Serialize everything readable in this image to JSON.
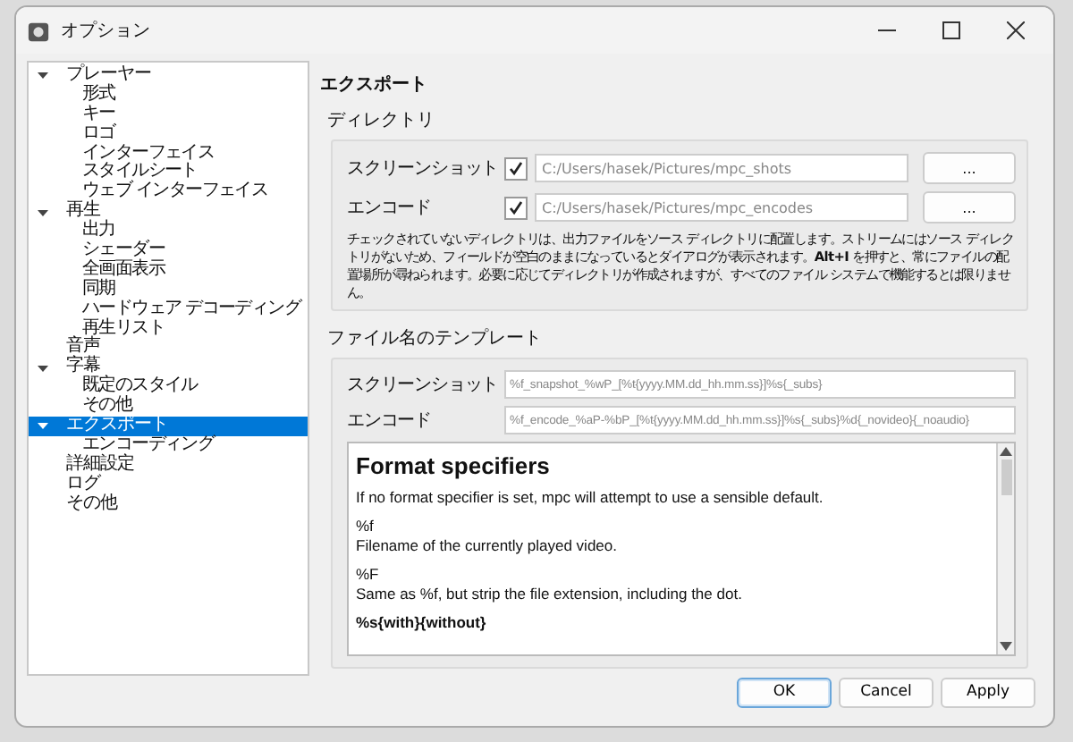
{
  "window": {
    "title": "オプション"
  },
  "tree": [
    {
      "label": "プレーヤー",
      "selected": false,
      "expanded": true,
      "children": [
        {
          "label": "形式",
          "selected": false
        },
        {
          "label": "キー",
          "selected": false
        },
        {
          "label": "ロゴ",
          "selected": false
        },
        {
          "label": "インターフェイス",
          "selected": false
        },
        {
          "label": "スタイルシート",
          "selected": false
        },
        {
          "label": "ウェブ インターフェイス",
          "selected": false
        }
      ]
    },
    {
      "label": "再生",
      "selected": false,
      "expanded": true,
      "children": [
        {
          "label": "出力",
          "selected": false
        },
        {
          "label": "シェーダー",
          "selected": false
        },
        {
          "label": "全画面表示",
          "selected": false
        },
        {
          "label": "同期",
          "selected": false
        },
        {
          "label": "ハードウェア デコーディング",
          "selected": false
        },
        {
          "label": "再生リスト",
          "selected": false
        }
      ]
    },
    {
      "label": "音声",
      "selected": false
    },
    {
      "label": "字幕",
      "selected": false,
      "expanded": true,
      "children": [
        {
          "label": "既定のスタイル",
          "selected": false
        },
        {
          "label": "その他",
          "selected": false
        }
      ]
    },
    {
      "label": "エクスポート",
      "selected": true,
      "expanded": true,
      "children": [
        {
          "label": "エンコーディング",
          "selected": false
        }
      ]
    },
    {
      "label": "詳細設定",
      "selected": false
    },
    {
      "label": "ログ",
      "selected": false
    },
    {
      "label": "その他",
      "selected": false
    }
  ],
  "page_title": "エクスポート",
  "directory": {
    "title": "ディレクトリ",
    "rows": [
      {
        "label": "スクリーンショット",
        "checked": true,
        "value": "C:/Users/hasek/Pictures/mpc_shots",
        "browse": "..."
      },
      {
        "label": "エンコード",
        "checked": true,
        "value": "C:/Users/hasek/Pictures/mpc_encodes",
        "browse": "..."
      }
    ],
    "note": "チェックされていないディレクトリは、出力ファイルをソース ディレクトリに配置します。ストリームにはソース ディレクトリがないため、フィールドが空白のままになっているとダイアログが表示されます。**Alt+I** を押すと、常にファイルの配置場所が尋ねられます。必要に応じてディレクトリが作成されますが、すべてのファイル システムで機能するとは限りません。"
  },
  "template": {
    "title": "ファイル名のテンプレート",
    "rows": [
      {
        "label": "スクリーンショット",
        "value": "%f_snapshot_%wP_[%t{yyyy.MM.dd_hh.mm.ss}]%s{_subs}"
      },
      {
        "label": "エンコード",
        "value": "%f_encode_%aP-%bP_[%t{yyyy.MM.dd_hh.mm.ss}]%s{_subs}%d{_novideo}{_noaudio}"
      }
    ],
    "help": {
      "heading": "Format specifiers",
      "intro": "If no format specifier is set, mpc will attempt to use a sensible default.",
      "entries": [
        {
          "code": "%f",
          "text": "Filename of the currently played video."
        },
        {
          "code": "%F",
          "text": "Same as %f, but strip the file extension, including the dot."
        },
        {
          "code": "%s{with}{without}"
        }
      ]
    }
  },
  "buttons": [
    {
      "label": "OK",
      "default": true
    },
    {
      "label": "Cancel",
      "default": false
    },
    {
      "label": "Apply",
      "default": false
    }
  ]
}
